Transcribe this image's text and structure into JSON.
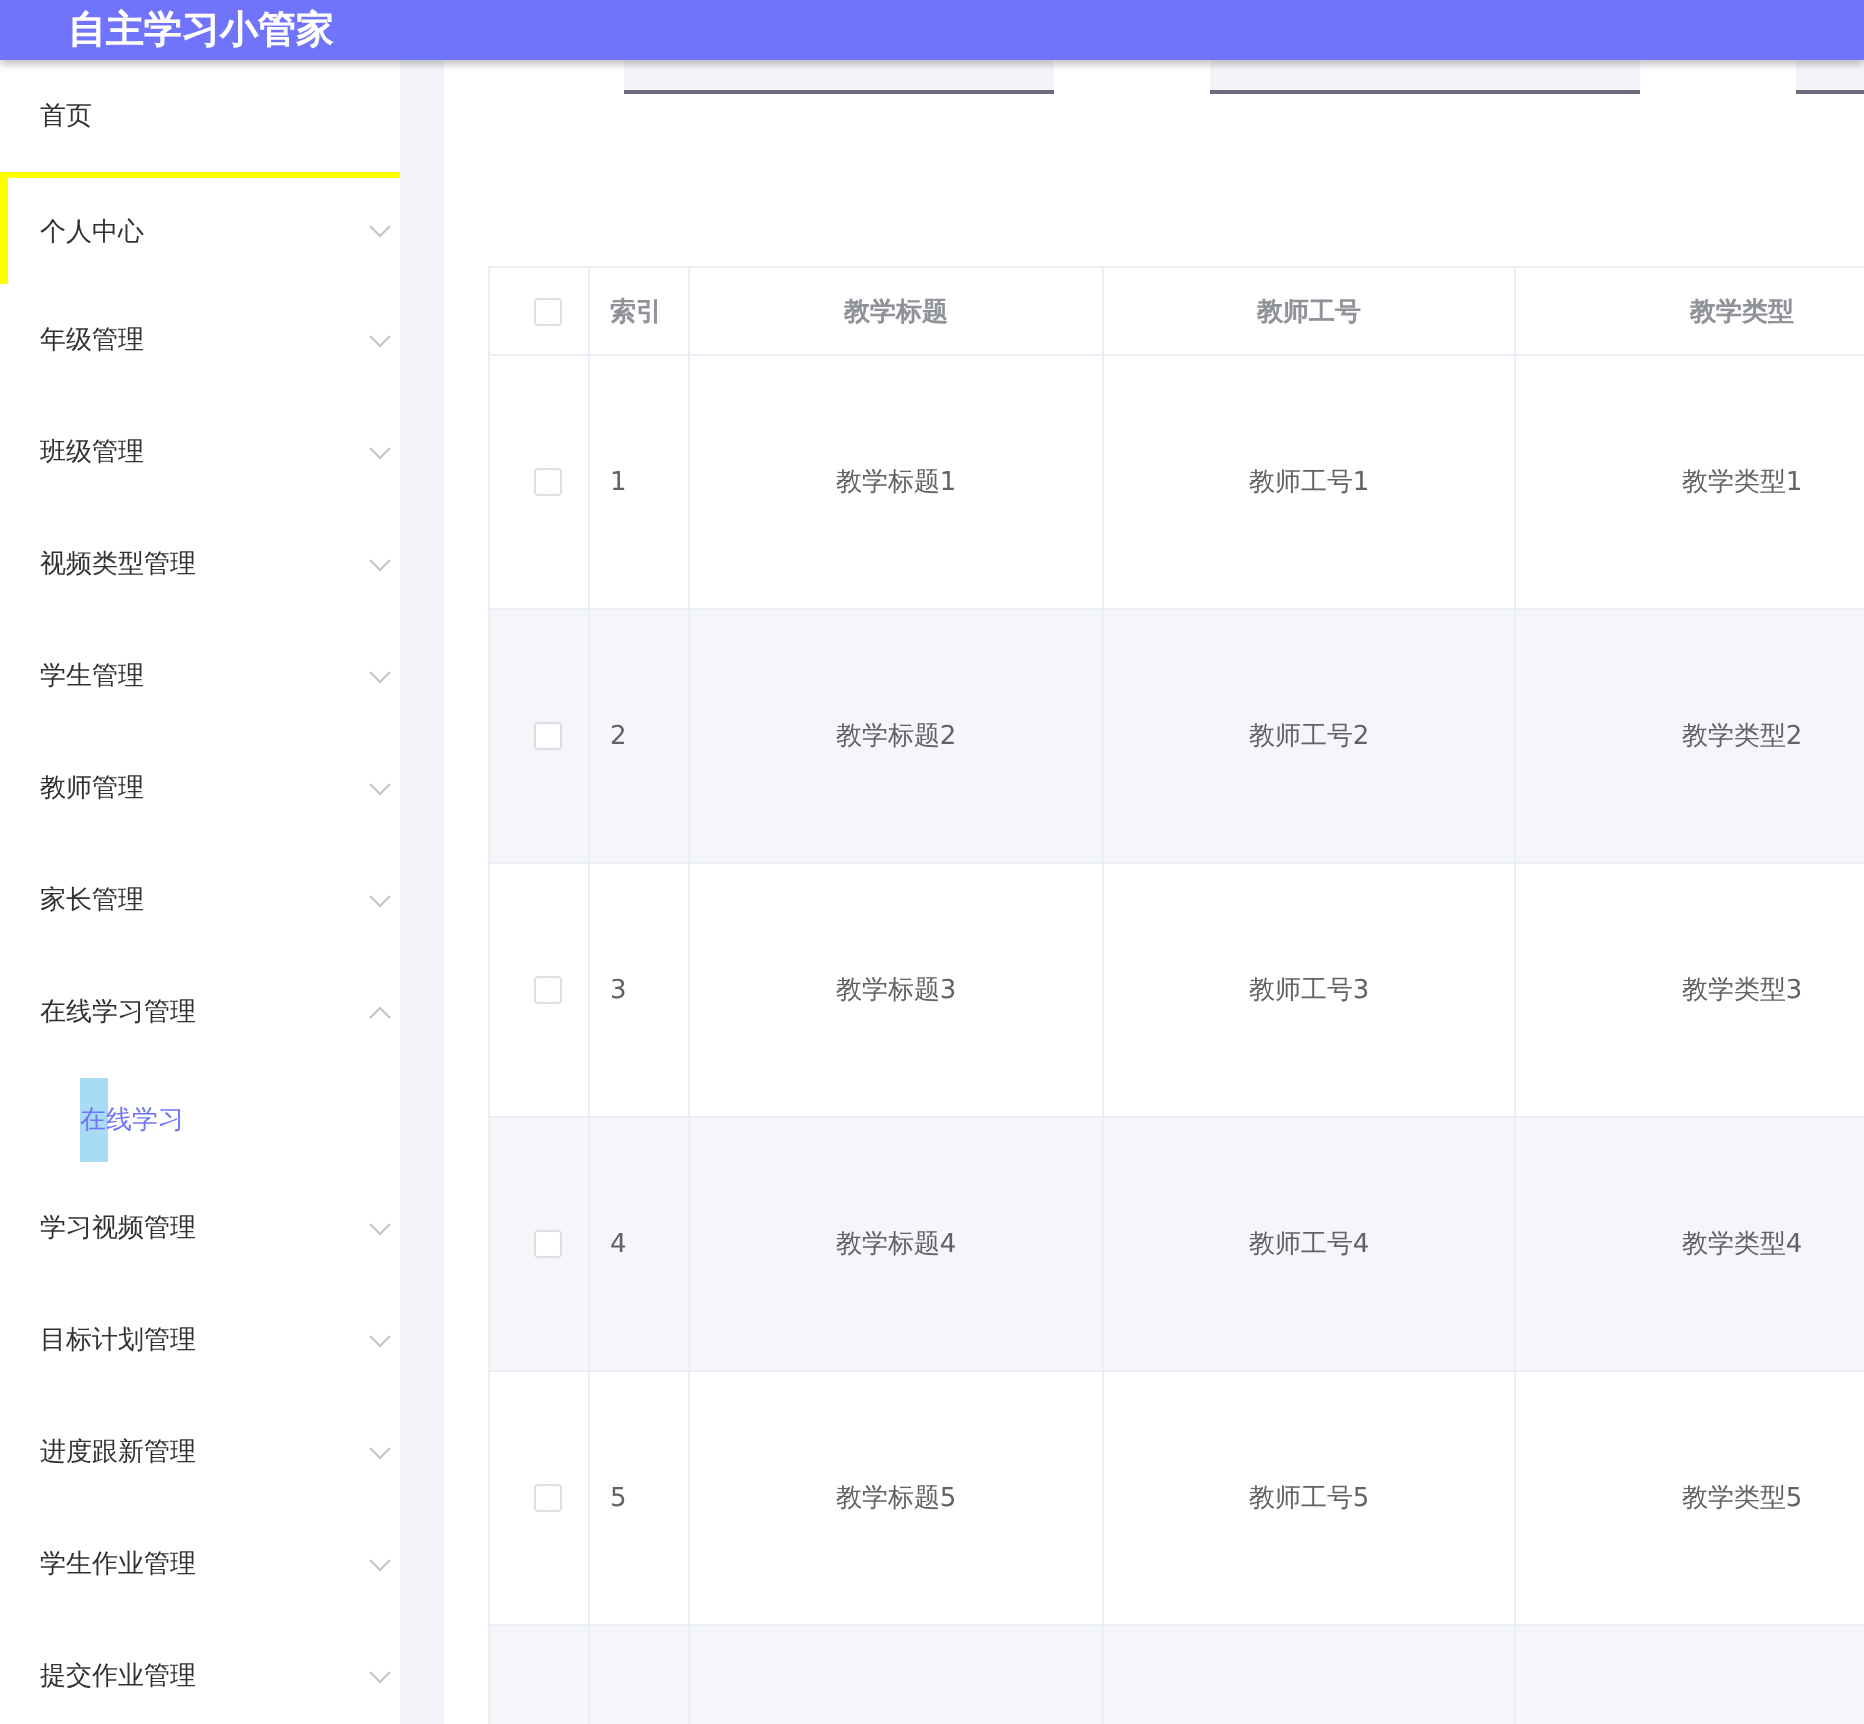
{
  "header": {
    "title": "自主学习小管家"
  },
  "sidebar": {
    "items": [
      {
        "kind": "link",
        "label": "首页",
        "selected": false
      },
      {
        "kind": "group",
        "label": "个人中心",
        "selected": true,
        "expanded": false
      },
      {
        "kind": "group",
        "label": "年级管理",
        "selected": false,
        "expanded": false
      },
      {
        "kind": "group",
        "label": "班级管理",
        "selected": false,
        "expanded": false
      },
      {
        "kind": "group",
        "label": "视频类型管理",
        "selected": false,
        "expanded": false
      },
      {
        "kind": "group",
        "label": "学生管理",
        "selected": false,
        "expanded": false
      },
      {
        "kind": "group",
        "label": "教师管理",
        "selected": false,
        "expanded": false
      },
      {
        "kind": "group",
        "label": "家长管理",
        "selected": false,
        "expanded": false
      },
      {
        "kind": "group",
        "label": "在线学习管理",
        "selected": false,
        "expanded": true,
        "children": [
          {
            "label": "在线学习",
            "selected": true
          }
        ]
      },
      {
        "kind": "group",
        "label": "学习视频管理",
        "selected": false,
        "expanded": false
      },
      {
        "kind": "group",
        "label": "目标计划管理",
        "selected": false,
        "expanded": false
      },
      {
        "kind": "group",
        "label": "进度跟新管理",
        "selected": false,
        "expanded": false
      },
      {
        "kind": "group",
        "label": "学生作业管理",
        "selected": false,
        "expanded": false
      },
      {
        "kind": "group",
        "label": "提交作业管理",
        "selected": false,
        "expanded": false
      }
    ]
  },
  "filters": [
    {
      "kind": "select"
    },
    {
      "kind": "select"
    },
    {
      "kind": "select"
    }
  ],
  "table": {
    "select_all": {
      "checked": false
    },
    "columns": [
      {
        "kind": "index",
        "label": "索引"
      },
      {
        "kind": "text",
        "label": "教学标题"
      },
      {
        "kind": "text",
        "label": "教师工号"
      },
      {
        "kind": "text",
        "label": "教学类型"
      }
    ],
    "rows": [
      {
        "checked": false,
        "cells": [
          "1",
          "教学标题1",
          "教师工号1",
          "教学类型1"
        ]
      },
      {
        "checked": false,
        "cells": [
          "2",
          "教学标题2",
          "教师工号2",
          "教学类型2"
        ]
      },
      {
        "checked": false,
        "cells": [
          "3",
          "教学标题3",
          "教师工号3",
          "教学类型3"
        ]
      },
      {
        "checked": false,
        "cells": [
          "4",
          "教学标题4",
          "教师工号4",
          "教学类型4"
        ]
      },
      {
        "checked": false,
        "cells": [
          "5",
          "教学标题5",
          "教师工号5",
          "教学类型5"
        ]
      }
    ]
  }
}
